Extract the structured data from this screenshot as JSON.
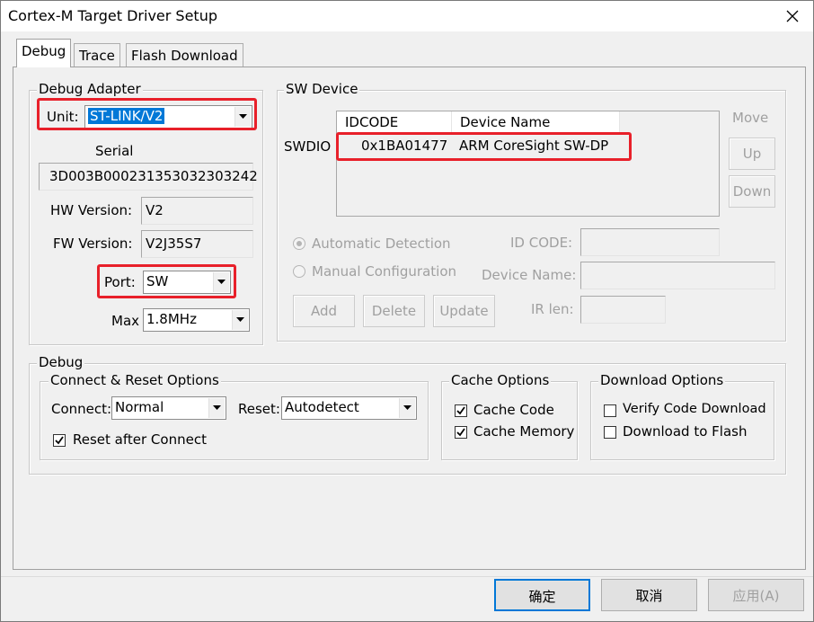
{
  "window": {
    "title": "Cortex-M Target Driver Setup"
  },
  "tabs": [
    {
      "label": "Debug",
      "active": true
    },
    {
      "label": "Trace",
      "active": false
    },
    {
      "label": "Flash Download",
      "active": false
    }
  ],
  "debug_adapter": {
    "legend": "Debug Adapter",
    "unit_label": "Unit:",
    "unit_value": "ST-LINK/V2",
    "serial_label": "Serial",
    "serial_value": "3D003B000231353032303242",
    "hw_label": "HW Version:",
    "hw_value": "V2",
    "fw_label": "FW Version:",
    "fw_value": "V2J35S7",
    "port_label": "Port:",
    "port_value": "SW",
    "max_label": "Max",
    "max_value": "1.8MHz"
  },
  "sw_device": {
    "legend": "SW Device",
    "columns": {
      "idcode": "IDCODE",
      "device_name": "Device Name"
    },
    "row_label": "SWDIO",
    "rows": [
      {
        "idcode": "0x1BA01477",
        "device_name": "ARM CoreSight SW-DP"
      }
    ],
    "move_label": "Move",
    "up_label": "Up",
    "down_label": "Down",
    "auto_detect_label": "Automatic Detection",
    "manual_config_label": "Manual Configuration",
    "id_code_label": "ID CODE:",
    "device_name_label": "Device Name:",
    "ir_len_label": "IR len:",
    "add_label": "Add",
    "delete_label": "Delete",
    "update_label": "Update"
  },
  "debug": {
    "legend": "Debug",
    "connect_reset": {
      "legend": "Connect & Reset Options",
      "connect_label": "Connect:",
      "connect_value": "Normal",
      "reset_label": "Reset:",
      "reset_value": "Autodetect",
      "reset_after_connect_label": "Reset after Connect",
      "reset_after_connect_checked": true
    },
    "cache": {
      "legend": "Cache Options",
      "cache_code_label": "Cache Code",
      "cache_code_checked": true,
      "cache_memory_label": "Cache Memory",
      "cache_memory_checked": true
    },
    "download": {
      "legend": "Download Options",
      "verify_label": "Verify Code Download",
      "verify_checked": false,
      "download_flash_label": "Download to Flash",
      "download_flash_checked": false
    }
  },
  "buttons": {
    "ok": "确定",
    "cancel": "取消",
    "apply": "应用(A)"
  },
  "colors": {
    "highlight": "#e8202a",
    "selection": "#0078d7"
  }
}
